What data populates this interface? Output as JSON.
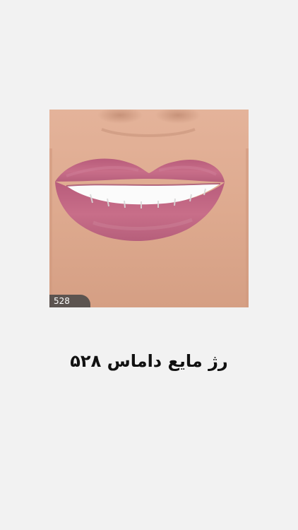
{
  "image": {
    "subject": "lips-photo",
    "badge_text": "528"
  },
  "title": {
    "text": "رژ مایع داماس ۵۲۸"
  },
  "colors": {
    "background": "#f2f2f2",
    "lip": "#c86e89",
    "skin": "#dfac90",
    "title": "#111111"
  }
}
